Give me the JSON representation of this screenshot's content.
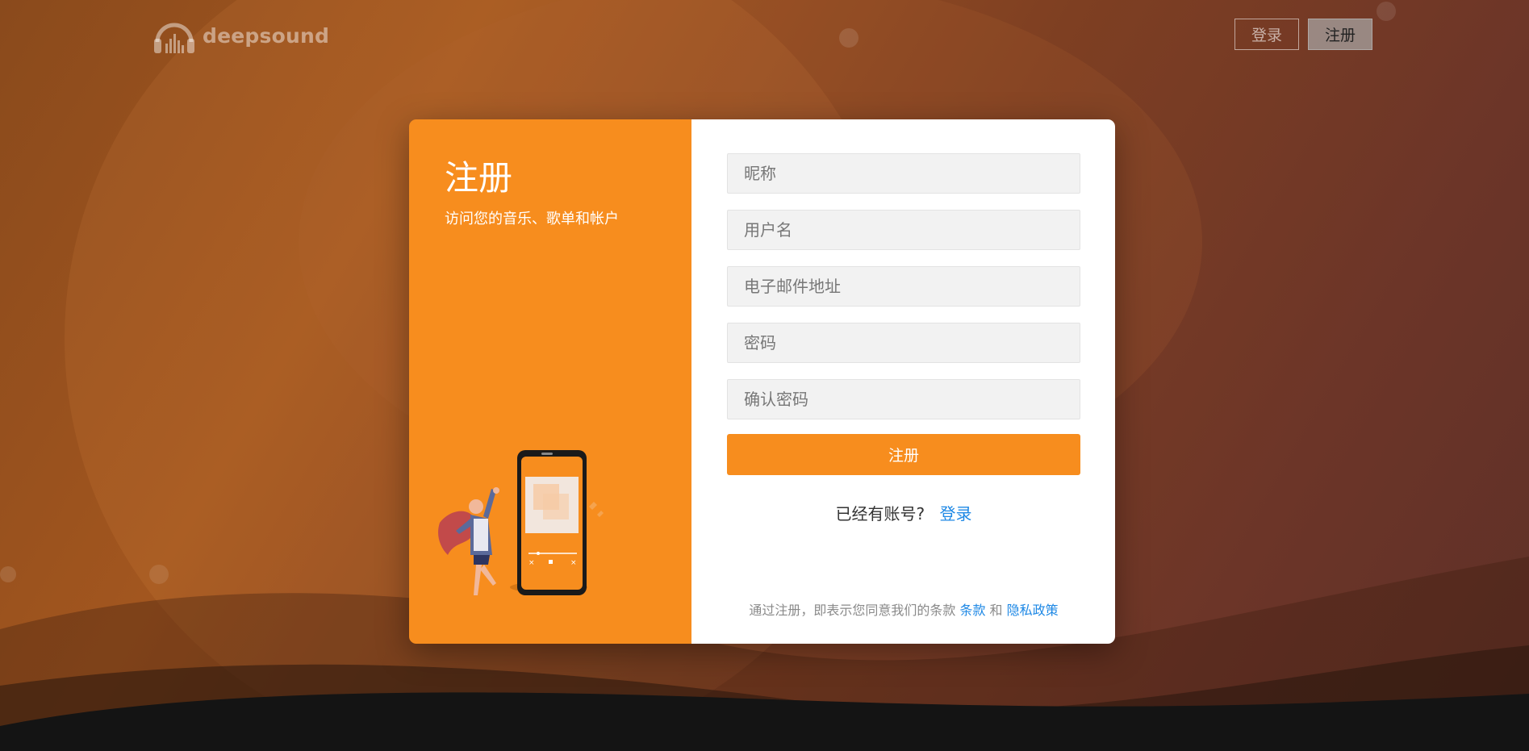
{
  "header": {
    "logo_text": "deepsound",
    "login_label": "登录",
    "register_label": "注册"
  },
  "panel": {
    "title": "注册",
    "subtitle": "访问您的音乐、歌单和帐户"
  },
  "form": {
    "nickname_placeholder": "昵称",
    "username_placeholder": "用户名",
    "email_placeholder": "电子邮件地址",
    "password_placeholder": "密码",
    "confirm_password_placeholder": "确认密码",
    "submit_label": "注册",
    "have_account_text": "已经有账号?",
    "login_link": "登录",
    "terms_prefix": "通过注册，即表示您同意我们的条款",
    "terms_link": "条款",
    "terms_and": "和",
    "privacy_link": "隐私政策"
  },
  "colors": {
    "accent": "#f78d1e",
    "link": "#1e88e5"
  }
}
